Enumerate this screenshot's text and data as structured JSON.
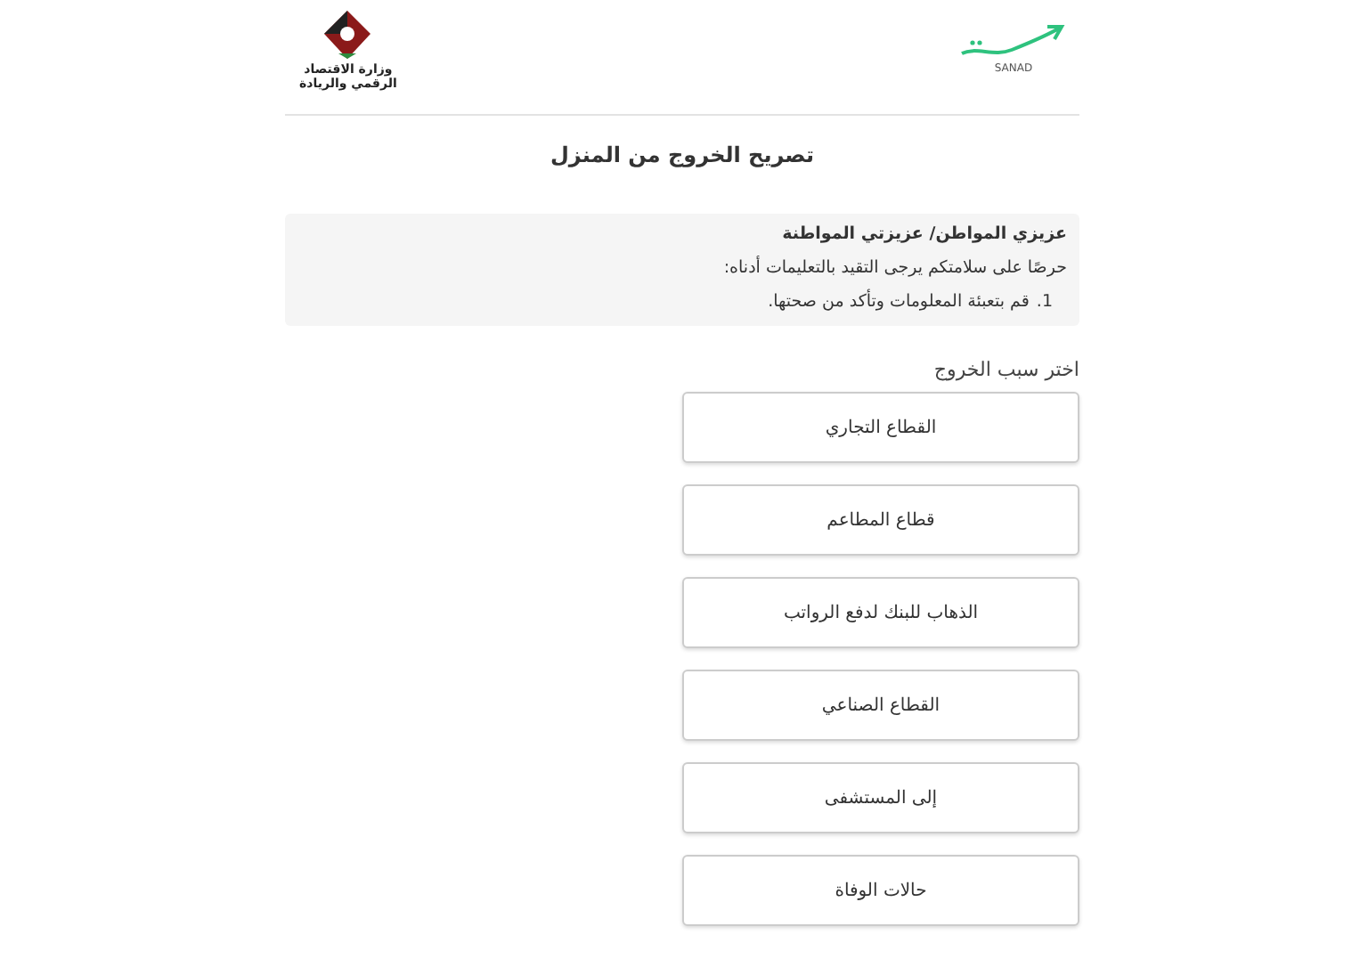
{
  "header": {
    "ministry_name": [
      "وزارة الاقتصاد",
      "الرقمي والريادة"
    ],
    "sanad_label": "SANAD"
  },
  "title": "تصريح الخروج من المنزل",
  "notice": {
    "heading": "عزيزي المواطن/ عزيزتي المواطنة",
    "text": "حرصًا على سلامتكم يرجى التقيد بالتعليمات أدناه:",
    "steps": [
      {
        "number": "1.",
        "text": "قم بتعبئة المعلومات وتأكد من صحتها."
      }
    ]
  },
  "reason_label": "اختر سبب الخروج",
  "reasons": [
    "القطاع التجاري",
    "قطاع المطاعم",
    "الذهاب للبنك لدفع الرواتب",
    "القطاع الصناعي",
    "إلى المستشفى",
    "حالات الوفاة"
  ]
}
